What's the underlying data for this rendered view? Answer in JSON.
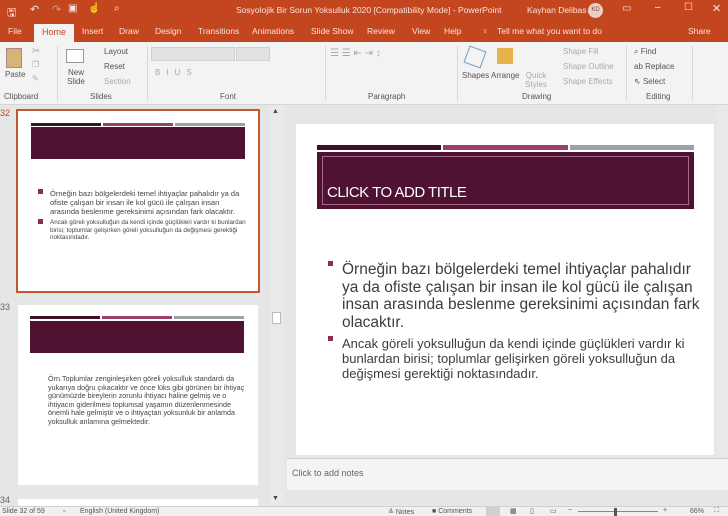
{
  "window": {
    "title": "Sosyolojik Bir Sorun Yoksulluk 2020 [Compatibility Mode] - PowerPoint",
    "user": "Kayhan Delibas",
    "user_initials": "KD"
  },
  "tabs": [
    "File",
    "Home",
    "Insert",
    "Draw",
    "Design",
    "Transitions",
    "Animations",
    "Slide Show",
    "Review",
    "View",
    "Help"
  ],
  "tell_me": "Tell me what you want to do",
  "share": "Share",
  "ribbon": {
    "clipboard": {
      "label": "Clipboard",
      "paste": "Paste"
    },
    "slides": {
      "label": "Slides",
      "new_slide": "New Slide",
      "layout": "Layout",
      "reset": "Reset",
      "section": "Section"
    },
    "font": {
      "label": "Font"
    },
    "paragraph": {
      "label": "Paragraph"
    },
    "drawing": {
      "label": "Drawing",
      "shapes": "Shapes",
      "arrange": "Arrange",
      "quick_styles": "Quick Styles",
      "shape_fill": "Shape Fill",
      "shape_outline": "Shape Outline",
      "shape_effects": "Shape Effects"
    },
    "editing": {
      "label": "Editing",
      "find": "Find",
      "replace": "Replace",
      "select": "Select"
    }
  },
  "thumbnails": [
    {
      "number": "32",
      "bullets": [
        "Örneğin bazı bölgelerdeki temel ihtiyaçlar pahalıdır ya da ofiste çalışan bir insan ile kol gücü ile çalışan insan arasında beslenme gereksinimi açısından fark olacaktır.",
        "Ancak göreli yoksulluğun da kendi içinde güçlükleri vardır ki bunlardan birisi; toplumlar gelişirken göreli yoksulluğun da değişmesi gerektiği noktasındadır."
      ]
    },
    {
      "number": "33",
      "text": "Örn.Toplumlar zenginleşirken göreli yoksulluk standardı da yukarıya doğru çıkacaktır ve önce lüks gibi görünen bir ihtiyaç günümüzde bireylerin zorunlu ihtiyacı haline gelmiş ve o ihtiyacın giderilmesi toplumsal yaşamın düzenlenmesinde önemli hale gelmiştir ve o ihtiyaçtan yoksunluk bir anlamda yoksulluk anlamına gelmektedir."
    },
    {
      "number": "34"
    }
  ],
  "slide": {
    "title": "CLICK TO ADD TITLE",
    "bullets": [
      "Örneğin bazı bölgelerdeki temel ihtiyaçlar pahalıdır ya da ofiste çalışan bir insan ile kol gücü ile çalışan insan arasında beslenme gereksinimi açısından fark olacaktır.",
      "Ancak göreli yoksulluğun da kendi içinde güçlükleri vardır ki bunlardan birisi; toplumlar gelişirken göreli yoksulluğun da değişmesi gerektiği noktasındadır."
    ]
  },
  "notes_placeholder": "Click to add notes",
  "status": {
    "slide": "Slide 32 of 59",
    "language": "English (United Kingdom)",
    "notes": "Notes",
    "comments": "Comments",
    "zoom": "66%"
  },
  "colors": {
    "accent": "#c4461f",
    "title_fill": "#4f1232",
    "bar2": "#9b3e69",
    "bar3": "#9aa2a6"
  }
}
